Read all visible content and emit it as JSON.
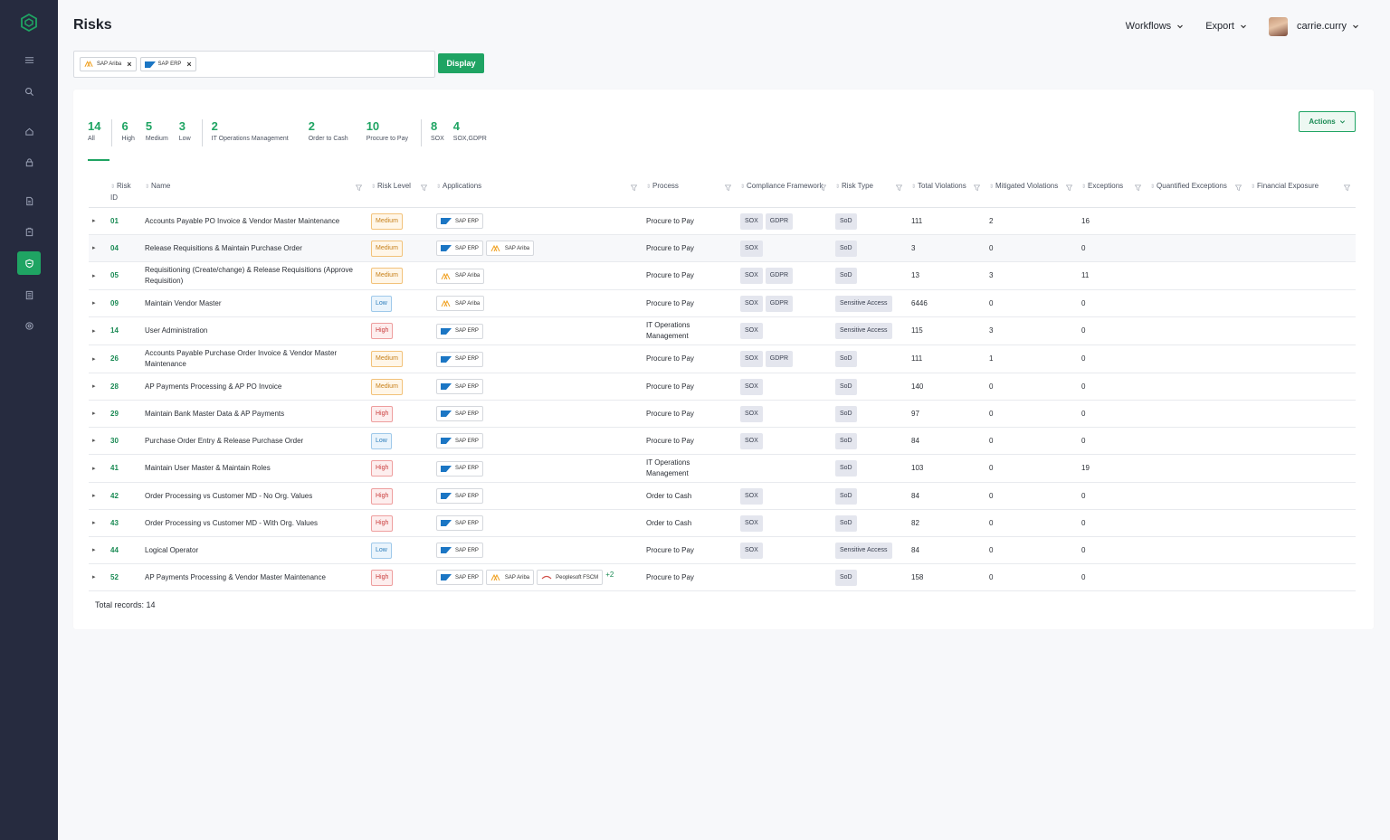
{
  "page": {
    "title": "Risks"
  },
  "top_nav": {
    "workflows": "Workflows",
    "export": "Export",
    "user": "carrie.curry"
  },
  "filter": {
    "chips": [
      "SAP Ariba",
      "SAP ERP"
    ],
    "display_label": "Display"
  },
  "stats": [
    {
      "num": "14",
      "label": "All"
    },
    {
      "num": "6",
      "label": "High"
    },
    {
      "num": "5",
      "label": "Medium"
    },
    {
      "num": "3",
      "label": "Low"
    },
    {
      "num": "2",
      "label": "IT Operations Management"
    },
    {
      "num": "2",
      "label": "Order to Cash"
    },
    {
      "num": "10",
      "label": "Procure to Pay"
    },
    {
      "num": "8",
      "label": "SOX"
    },
    {
      "num": "4",
      "label": "SOX,GDPR"
    }
  ],
  "actions_label": "Actions",
  "columns": {
    "risk_id": "Risk ID",
    "name": "Name",
    "risk_level": "Risk Level",
    "applications": "Applications",
    "process": "Process",
    "compliance": "Compliance Framework",
    "risk_type": "Risk Type",
    "total_violations": "Total Violations",
    "mitigated": "Mitigated Violations",
    "exceptions": "Exceptions",
    "quantified": "Quantified Exceptions",
    "financial": "Financial Exposure"
  },
  "rows": [
    {
      "id": "01",
      "name": "Accounts Payable PO Invoice & Vendor Master Maintenance",
      "level": "Medium",
      "apps": [
        "SAP ERP"
      ],
      "more": "",
      "process": "Procure to Pay",
      "frameworks": [
        "SOX",
        "GDPR"
      ],
      "type": "SoD",
      "total": "111",
      "mitigated": "2",
      "exceptions": "16"
    },
    {
      "id": "04",
      "name": "Release Requisitions & Maintain Purchase Order",
      "level": "Medium",
      "apps": [
        "SAP ERP",
        "SAP Ariba"
      ],
      "more": "",
      "process": "Procure to Pay",
      "frameworks": [
        "SOX"
      ],
      "type": "SoD",
      "total": "3",
      "mitigated": "0",
      "exceptions": "0"
    },
    {
      "id": "05",
      "name": "Requisitioning (Create/change) & Release Requisitions (Approve Requisition)",
      "level": "Medium",
      "apps": [
        "SAP Ariba"
      ],
      "more": "",
      "process": "Procure to Pay",
      "frameworks": [
        "SOX",
        "GDPR"
      ],
      "type": "SoD",
      "total": "13",
      "mitigated": "3",
      "exceptions": "11"
    },
    {
      "id": "09",
      "name": "Maintain Vendor Master",
      "level": "Low",
      "apps": [
        "SAP Ariba"
      ],
      "more": "",
      "process": "Procure to Pay",
      "frameworks": [
        "SOX",
        "GDPR"
      ],
      "type": "Sensitive Access",
      "total": "6446",
      "mitigated": "0",
      "exceptions": "0"
    },
    {
      "id": "14",
      "name": "User Administration",
      "level": "High",
      "apps": [
        "SAP ERP"
      ],
      "more": "",
      "process": "IT Operations Management",
      "frameworks": [
        "SOX"
      ],
      "type": "Sensitive Access",
      "total": "115",
      "mitigated": "3",
      "exceptions": "0"
    },
    {
      "id": "26",
      "name": "Accounts Payable Purchase Order Invoice & Vendor Master Maintenance",
      "level": "Medium",
      "apps": [
        "SAP ERP"
      ],
      "more": "",
      "process": "Procure to Pay",
      "frameworks": [
        "SOX",
        "GDPR"
      ],
      "type": "SoD",
      "total": "111",
      "mitigated": "1",
      "exceptions": "0"
    },
    {
      "id": "28",
      "name": "AP Payments Processing & AP PO Invoice",
      "level": "Medium",
      "apps": [
        "SAP ERP"
      ],
      "more": "",
      "process": "Procure to Pay",
      "frameworks": [
        "SOX"
      ],
      "type": "SoD",
      "total": "140",
      "mitigated": "0",
      "exceptions": "0"
    },
    {
      "id": "29",
      "name": "Maintain Bank Master Data & AP Payments",
      "level": "High",
      "apps": [
        "SAP ERP"
      ],
      "more": "",
      "process": "Procure to Pay",
      "frameworks": [
        "SOX"
      ],
      "type": "SoD",
      "total": "97",
      "mitigated": "0",
      "exceptions": "0"
    },
    {
      "id": "30",
      "name": "Purchase Order Entry & Release Purchase Order",
      "level": "Low",
      "apps": [
        "SAP ERP"
      ],
      "more": "",
      "process": "Procure to Pay",
      "frameworks": [
        "SOX"
      ],
      "type": "SoD",
      "total": "84",
      "mitigated": "0",
      "exceptions": "0"
    },
    {
      "id": "41",
      "name": "Maintain User Master & Maintain Roles",
      "level": "High",
      "apps": [
        "SAP ERP"
      ],
      "more": "",
      "process": "IT Operations Management",
      "frameworks": [],
      "type": "SoD",
      "total": "103",
      "mitigated": "0",
      "exceptions": "19"
    },
    {
      "id": "42",
      "name": "Order Processing vs Customer MD - No Org. Values",
      "level": "High",
      "apps": [
        "SAP ERP"
      ],
      "more": "",
      "process": "Order to Cash",
      "frameworks": [
        "SOX"
      ],
      "type": "SoD",
      "total": "84",
      "mitigated": "0",
      "exceptions": "0"
    },
    {
      "id": "43",
      "name": "Order Processing vs Customer MD - With Org. Values",
      "level": "High",
      "apps": [
        "SAP ERP"
      ],
      "more": "",
      "process": "Order to Cash",
      "frameworks": [
        "SOX"
      ],
      "type": "SoD",
      "total": "82",
      "mitigated": "0",
      "exceptions": "0"
    },
    {
      "id": "44",
      "name": "Logical Operator",
      "level": "Low",
      "apps": [
        "SAP ERP"
      ],
      "more": "",
      "process": "Procure to Pay",
      "frameworks": [
        "SOX"
      ],
      "type": "Sensitive Access",
      "total": "84",
      "mitigated": "0",
      "exceptions": "0"
    },
    {
      "id": "52",
      "name": "AP Payments Processing & Vendor Master Maintenance",
      "level": "High",
      "apps": [
        "SAP ERP",
        "SAP Ariba",
        "Peoplesoft FSCM"
      ],
      "more": "+2",
      "process": "Procure to Pay",
      "frameworks": [],
      "type": "SoD",
      "total": "158",
      "mitigated": "0",
      "exceptions": "0"
    }
  ],
  "total_records": "Total records: 14",
  "colors": {
    "accent": "#1fa463",
    "sidebar": "#262b3f"
  }
}
